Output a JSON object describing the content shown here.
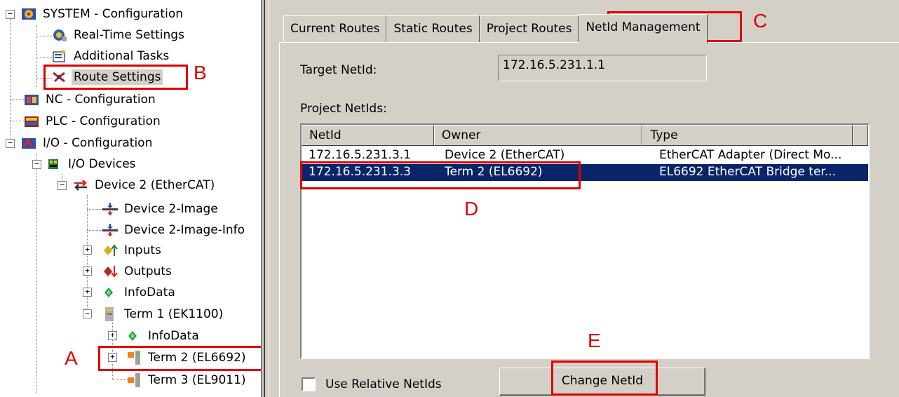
{
  "tree": {
    "items": [
      {
        "label": "SYSTEM - Configuration",
        "icon": "system-config-icon"
      },
      {
        "label": "Real-Time Settings",
        "icon": "realtime-icon"
      },
      {
        "label": "Additional Tasks",
        "icon": "tasks-icon"
      },
      {
        "label": "Route Settings",
        "icon": "route-icon"
      },
      {
        "label": "NC - Configuration",
        "icon": "nc-icon"
      },
      {
        "label": "PLC - Configuration",
        "icon": "plc-icon"
      },
      {
        "label": "I/O - Configuration",
        "icon": "io-config-icon"
      },
      {
        "label": "I/O Devices",
        "icon": "io-devices-icon"
      },
      {
        "label": "Device 2 (EtherCAT)",
        "icon": "ethercat-device-icon"
      },
      {
        "label": "Device 2-Image",
        "icon": "image-icon"
      },
      {
        "label": "Device 2-Image-Info",
        "icon": "image-info-icon"
      },
      {
        "label": "Inputs",
        "icon": "inputs-icon"
      },
      {
        "label": "Outputs",
        "icon": "outputs-icon"
      },
      {
        "label": "InfoData",
        "icon": "infodata-icon"
      },
      {
        "label": "Term 1 (EK1100)",
        "icon": "terminal-icon"
      },
      {
        "label": "InfoData",
        "icon": "infodata-icon"
      },
      {
        "label": "Term 2 (EL6692)",
        "icon": "terminal-icon"
      },
      {
        "label": "Term 3 (EL9011)",
        "icon": "terminal-icon"
      }
    ]
  },
  "callouts": {
    "a": "A",
    "b": "B",
    "c": "C",
    "d": "D",
    "e": "E"
  },
  "tabs": [
    "Current Routes",
    "Static Routes",
    "Project Routes",
    "NetId Management"
  ],
  "target_netid_label": "Target NetId:",
  "target_netid_value": "172.16.5.231.1.1",
  "project_netids_label": "Project NetIds:",
  "list": {
    "columns": [
      "NetId",
      "Owner",
      "Type"
    ],
    "rows": [
      {
        "netid": "172.16.5.231.3.1",
        "owner": "Device 2 (EtherCAT)",
        "type": "EtherCAT Adapter (Direct Mo..."
      },
      {
        "netid": "172.16.5.231.3.3",
        "owner": "Term 2 (EL6692)",
        "type": "EL6692 EtherCAT Bridge ter..."
      }
    ]
  },
  "use_relative_label": "Use Relative NetIds",
  "change_netid_button": "Change NetId",
  "colors": {
    "callout": "#e00000",
    "selection": "#0a246a",
    "panel": "#d4d0c8"
  }
}
